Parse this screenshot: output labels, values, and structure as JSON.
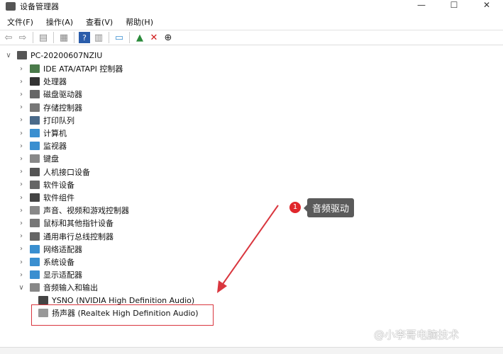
{
  "title": "设备管理器",
  "window_buttons": [
    "—",
    "☐",
    "✕"
  ],
  "menu": [
    "文件(F)",
    "操作(A)",
    "查看(V)",
    "帮助(H)"
  ],
  "toolbar_icons": [
    "back-icon",
    "forward-icon",
    "properties-icon",
    "list-icon",
    "help-icon",
    "view-icon",
    "monitor-icon",
    "update-driver-icon",
    "uninstall-icon",
    "download-icon"
  ],
  "root": "PC-20200607NZIU",
  "categories": [
    "IDE ATA/ATAPI 控制器",
    "处理器",
    "磁盘驱动器",
    "存储控制器",
    "打印队列",
    "计算机",
    "监视器",
    "键盘",
    "人机接口设备",
    "软件设备",
    "软件组件",
    "声音、视频和游戏控制器",
    "鼠标和其他指针设备",
    "通用串行总线控制器",
    "网络适配器",
    "系统设备",
    "显示适配器",
    "音频输入和输出"
  ],
  "children": [
    "YSNO (NVIDIA High Definition Audio)",
    "扬声器 (Realtek High Definition Audio)"
  ],
  "callout": {
    "number": "1",
    "text": "音频驱动"
  },
  "watermark": "@小李哥电脑技术",
  "colors": {
    "accent": "#e0262b",
    "callout_bg": "#5a5a5a"
  }
}
